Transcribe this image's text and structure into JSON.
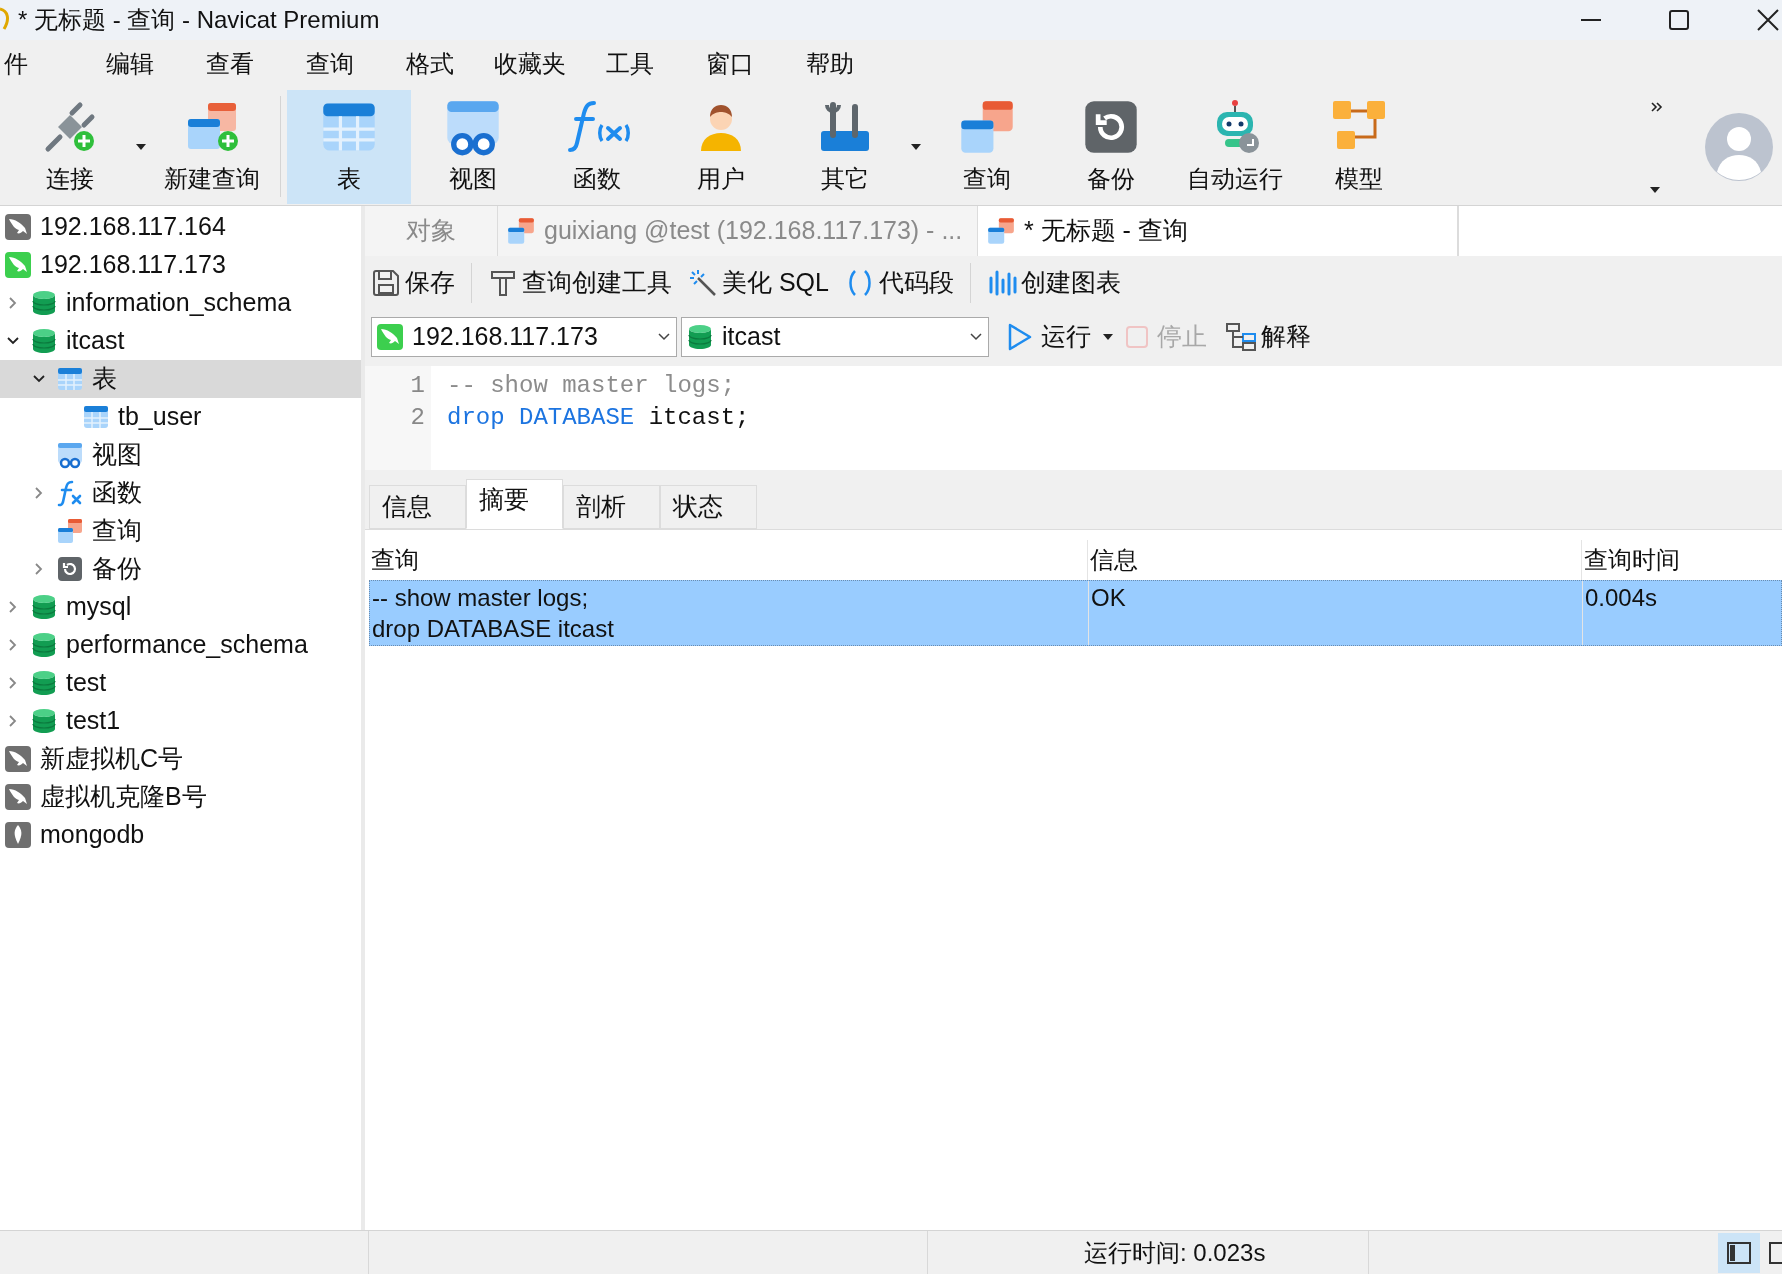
{
  "title_bar": {
    "title": "* 无标题 - 查询 - Navicat Premium"
  },
  "menu": [
    "件",
    "编辑",
    "查看",
    "查询",
    "格式",
    "收藏夹",
    "工具",
    "窗口",
    "帮助"
  ],
  "toolbar": [
    {
      "label": "连接",
      "kind": "connect",
      "selected": false,
      "dropdown": true
    },
    {
      "label": "新建查询",
      "kind": "new-query",
      "selected": false,
      "dropdown": false
    },
    {
      "label": "表",
      "kind": "table",
      "selected": true,
      "dropdown": false
    },
    {
      "label": "视图",
      "kind": "view",
      "selected": false,
      "dropdown": false
    },
    {
      "label": "函数",
      "kind": "function",
      "selected": false,
      "dropdown": false
    },
    {
      "label": "用户",
      "kind": "user",
      "selected": false,
      "dropdown": false
    },
    {
      "label": "其它",
      "kind": "tools",
      "selected": false,
      "dropdown": true
    },
    {
      "label": "查询",
      "kind": "query",
      "selected": false,
      "dropdown": false
    },
    {
      "label": "备份",
      "kind": "backup",
      "selected": false,
      "dropdown": false
    },
    {
      "label": "自动运行",
      "kind": "robot",
      "selected": false,
      "dropdown": false
    },
    {
      "label": "模型",
      "kind": "model",
      "selected": false,
      "dropdown": false
    }
  ],
  "sidebar": {
    "tree": [
      {
        "label": "192.168.117.164",
        "kind": "server",
        "connected": false,
        "selected": false
      },
      {
        "label": "192.168.117.173",
        "kind": "server",
        "connected": true,
        "selected": false
      },
      {
        "label": "information_schema",
        "kind": "database",
        "expanded": false,
        "selected": false
      },
      {
        "label": "itcast",
        "kind": "database",
        "expanded": true,
        "selected": false,
        "children": [
          {
            "label": "表",
            "kind": "table",
            "expanded": true,
            "selected": true,
            "children": [
              {
                "label": "tb_user",
                "kind": "table",
                "selected": false
              }
            ]
          },
          {
            "label": "视图",
            "kind": "view",
            "selected": false
          },
          {
            "label": "函数",
            "kind": "function",
            "expanded": false,
            "selected": false
          },
          {
            "label": "查询",
            "kind": "query",
            "selected": false
          },
          {
            "label": "备份",
            "kind": "backup",
            "expanded": false,
            "selected": false
          }
        ]
      },
      {
        "label": "mysql",
        "kind": "database",
        "expanded": false,
        "selected": false
      },
      {
        "label": "performance_schema",
        "kind": "database",
        "expanded": false,
        "selected": false
      },
      {
        "label": "test",
        "kind": "database",
        "expanded": false,
        "selected": false
      },
      {
        "label": "test1",
        "kind": "database",
        "expanded": false,
        "selected": false
      },
      {
        "label": "新虚拟机C号",
        "kind": "server",
        "connected": false,
        "selected": false
      },
      {
        "label": "虚拟机克隆B号",
        "kind": "server",
        "connected": false,
        "selected": false
      },
      {
        "label": "mongodb",
        "kind": "mongo",
        "selected": false
      }
    ]
  },
  "tabs": [
    {
      "label": "对象",
      "kind": "objects",
      "selected": false
    },
    {
      "label": "guixiang @test (192.168.117.173) - ...",
      "kind": "query",
      "selected": false
    },
    {
      "label": "* 无标题 - 查询",
      "kind": "query",
      "selected": true
    }
  ],
  "query_toolbar": [
    {
      "label": "保存",
      "kind": "save"
    },
    {
      "label": "查询创建工具",
      "kind": "builder"
    },
    {
      "label": "美化 SQL",
      "kind": "beautify"
    },
    {
      "label": "代码段",
      "kind": "snippet"
    },
    {
      "label": "创建图表",
      "kind": "chart"
    }
  ],
  "connection_select": {
    "value": "192.168.117.173"
  },
  "database_select": {
    "value": "itcast"
  },
  "run_button": {
    "label": "运行"
  },
  "stop_button": {
    "label": "停止",
    "disabled": true
  },
  "explain_button": {
    "label": "解释"
  },
  "editor": {
    "lines": [
      {
        "number": "1",
        "segments": [
          {
            "text": "-- show master logs;",
            "kind": "comment"
          }
        ]
      },
      {
        "number": "2",
        "segments": [
          {
            "text": "drop",
            "kind": "keyword"
          },
          {
            "text": " DATABASE",
            "kind": "keyword"
          },
          {
            "text": " itcast;",
            "kind": "plain"
          }
        ]
      }
    ]
  },
  "result_tabs": [
    {
      "label": "信息",
      "selected": false
    },
    {
      "label": "摘要",
      "selected": true
    },
    {
      "label": "剖析",
      "selected": false
    },
    {
      "label": "状态",
      "selected": false
    }
  ],
  "result_table": {
    "columns": [
      "查询",
      "信息",
      "查询时间"
    ],
    "rows": [
      {
        "cells": [
          "-- show master logs;\ndrop DATABASE itcast",
          "OK",
          "0.004s"
        ],
        "selected": true
      }
    ]
  },
  "status_bar": {
    "run_time": "运行时间: 0.023s"
  }
}
